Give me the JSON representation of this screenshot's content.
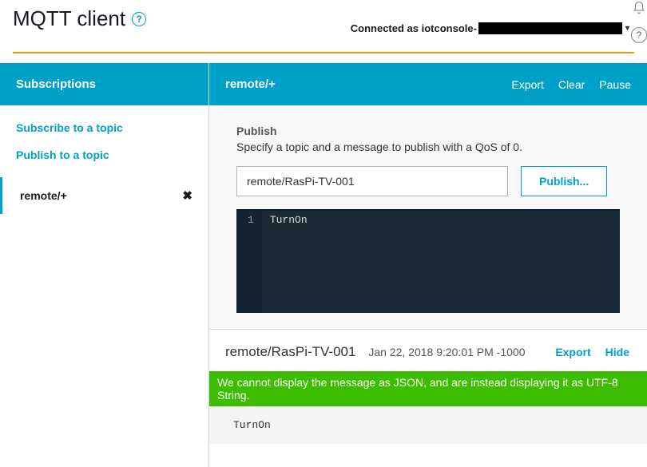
{
  "header": {
    "title": "MQTT client",
    "connected_prefix": "Connected as iotconsole-"
  },
  "sidebar": {
    "header": "Subscriptions",
    "subscribe_link": "Subscribe to a topic",
    "publish_link": "Publish to a topic",
    "subscription": {
      "name": "remote/+"
    }
  },
  "content": {
    "header_title": "remote/+",
    "actions": {
      "export": "Export",
      "clear": "Clear",
      "pause": "Pause"
    },
    "publish": {
      "label": "Publish",
      "description": "Specify a topic and a message to publish with a QoS of 0.",
      "topic_value": "remote/RasPi-TV-001",
      "button": "Publish...",
      "editor_line": "1",
      "editor_text": "TurnOn"
    },
    "message": {
      "topic": "remote/RasPi-TV-001",
      "timestamp": "Jan 22, 2018 9:20:01 PM -1000",
      "export": "Export",
      "hide": "Hide",
      "warning": "We cannot display the message as JSON, and are instead displaying it as UTF-8 String.",
      "body": "TurnOn"
    }
  }
}
